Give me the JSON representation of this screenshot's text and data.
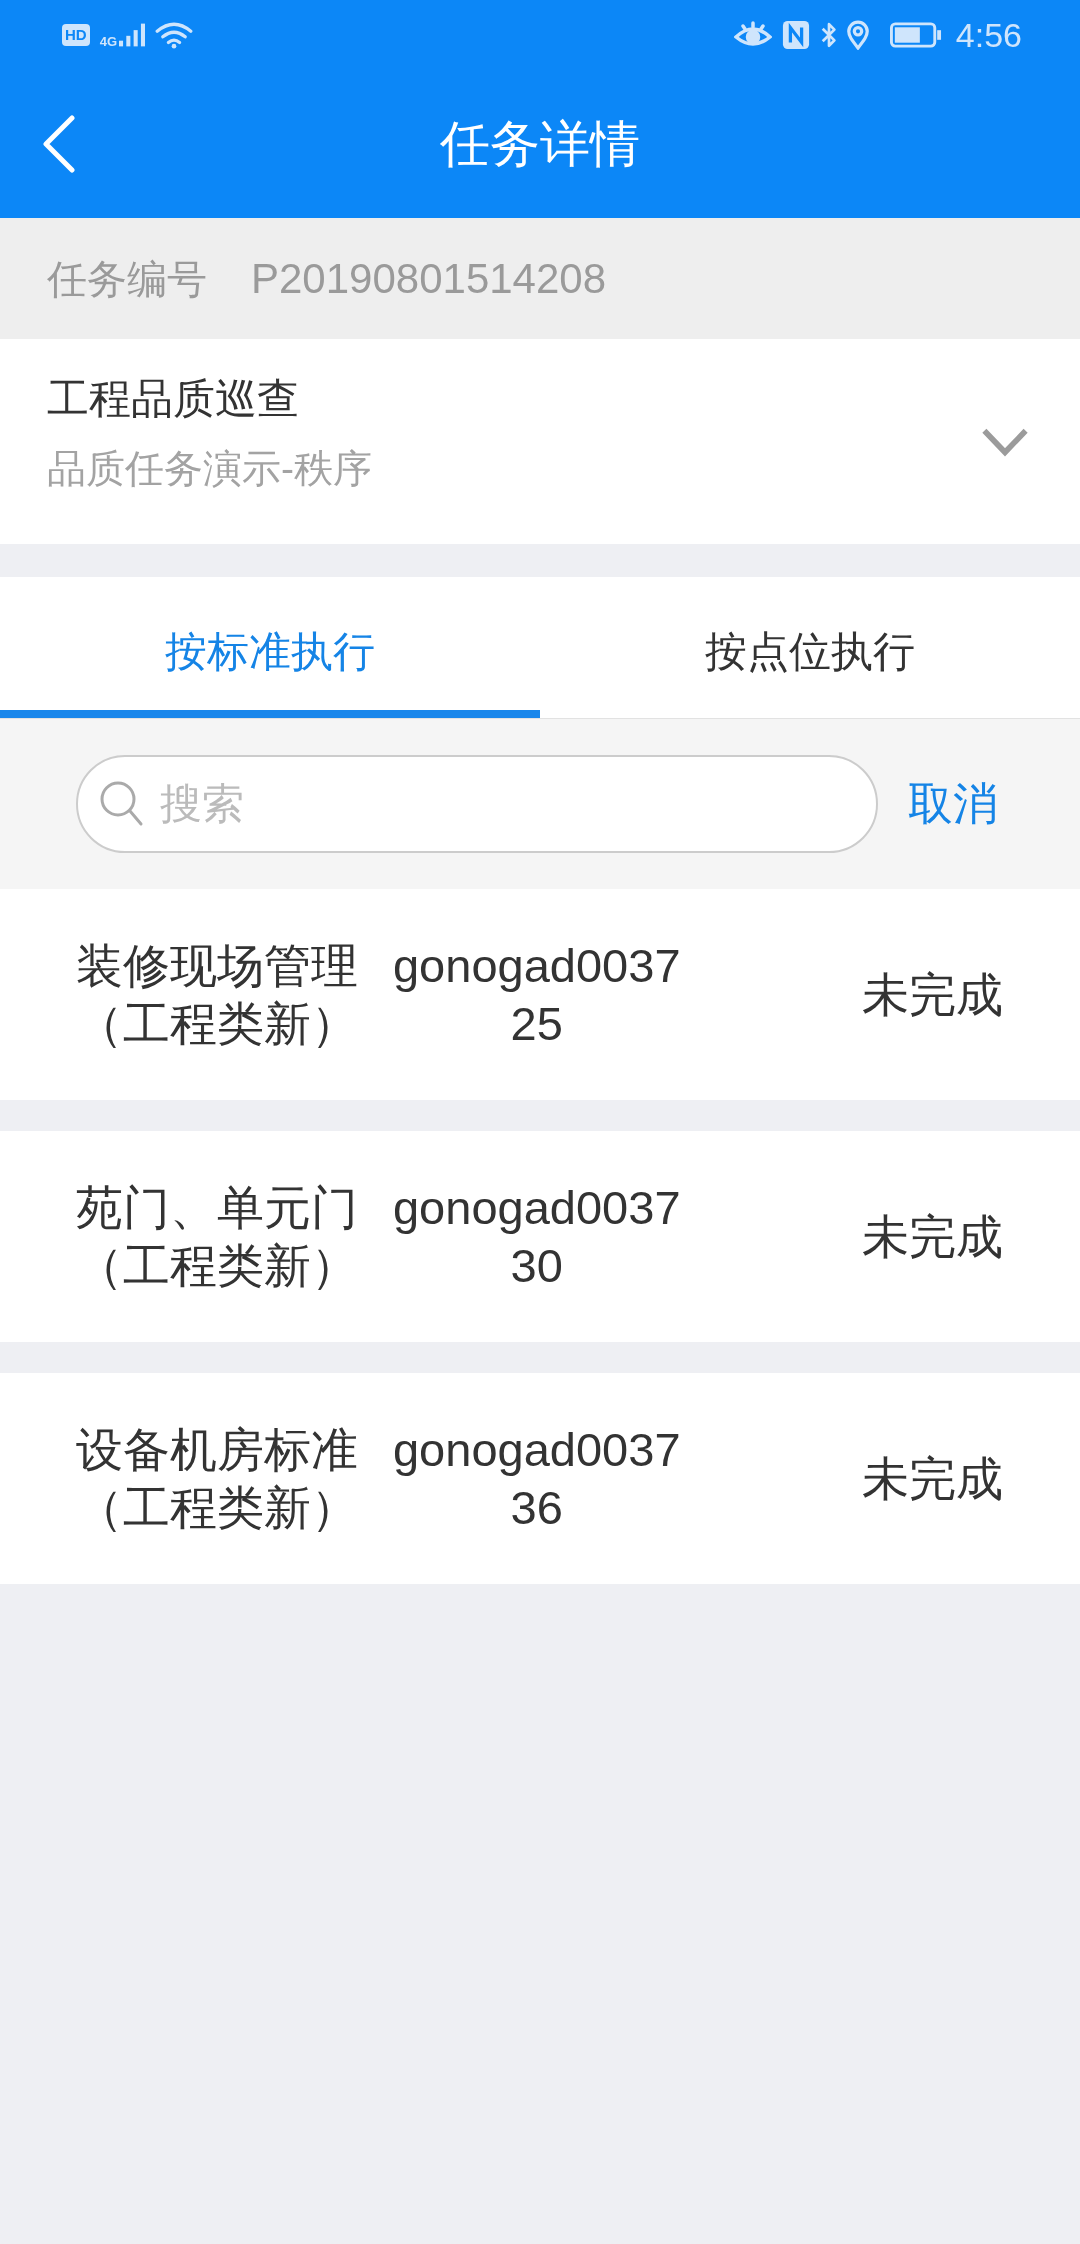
{
  "status_bar": {
    "hd": "HD",
    "network": "4G",
    "time": "4:56"
  },
  "header": {
    "title": "任务详情"
  },
  "task_number": {
    "label": "任务编号",
    "value": "P20190801514208"
  },
  "task_card": {
    "title": "工程品质巡查",
    "subtitle": "品质任务演示-秩序",
    "expanded": false
  },
  "tabs": [
    {
      "label": "按标准执行",
      "selected": true
    },
    {
      "label": "按点位执行",
      "selected": false
    }
  ],
  "search": {
    "placeholder": "搜索",
    "cancel": "取消"
  },
  "rows": [
    {
      "name": "装修现场管理（工程类新）",
      "code": "gonogad003725",
      "status": "未完成"
    },
    {
      "name": "苑门、单元门（工程类新）",
      "code": "gonogad003730",
      "status": "未完成"
    },
    {
      "name": "设备机房标准（工程类新）",
      "code": "gonogad003736",
      "status": "未完成"
    }
  ]
}
